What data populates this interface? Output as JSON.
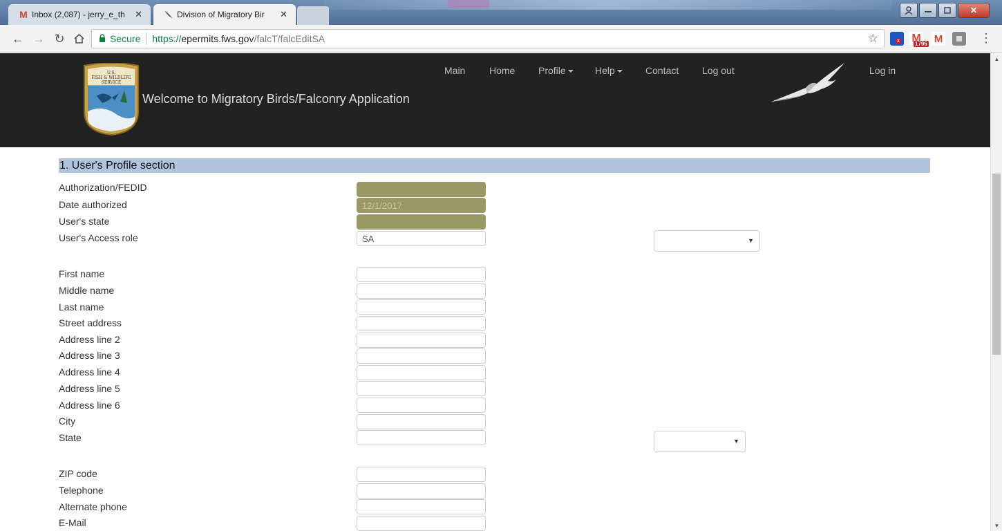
{
  "browser": {
    "tabs": [
      {
        "title": "Inbox (2,087) - jerry_e_th",
        "icon": "gmail-icon",
        "active": false
      },
      {
        "title": "Division of Migratory Bir",
        "icon": "bird-favicon-icon",
        "active": true
      }
    ],
    "secure_label": "Secure",
    "url_protocol": "https://",
    "url_host": "epermits.fws.gov",
    "url_path": "/falcT/falcEditSA",
    "extension_badge": "1796"
  },
  "header": {
    "welcome": "Welcome to Migratory Birds/Falconry Application",
    "logo_text_top": "U.S.",
    "logo_text_mid": "FISH & WILDLIFE",
    "logo_text_bot": "SERVICE",
    "nav": {
      "main": "Main",
      "home": "Home",
      "profile": "Profile",
      "help": "Help",
      "contact": "Contact",
      "logout": "Log out",
      "login": "Log in"
    }
  },
  "section": {
    "title": "1. User's Profile section"
  },
  "form": {
    "authorization_label": "Authorization/FEDID",
    "authorization_value": "",
    "date_authorized_label": "Date authorized",
    "date_authorized_value": "12/1/2017",
    "users_state_label": "User's state",
    "users_state_value": "",
    "access_role_label": "User's Access role",
    "access_role_value": "SA",
    "access_role_select_value": "",
    "first_name_label": "First name",
    "middle_name_label": "Middle name",
    "last_name_label": "Last name",
    "street_address_label": "Street address",
    "address2_label": "Address line 2",
    "address3_label": "Address line 3",
    "address4_label": "Address line 4",
    "address5_label": "Address line 5",
    "address6_label": "Address line 6",
    "city_label": "City",
    "state_label": "State",
    "state_select_value": "",
    "zip_label": "ZIP code",
    "telephone_label": "Telephone",
    "alt_phone_label": "Alternate phone",
    "email_label": "E-Mail"
  },
  "colors": {
    "header_bg": "#222222",
    "section_bar": "#b0c4de",
    "readonly_field": "#999966",
    "secure_green": "#0b8043"
  }
}
